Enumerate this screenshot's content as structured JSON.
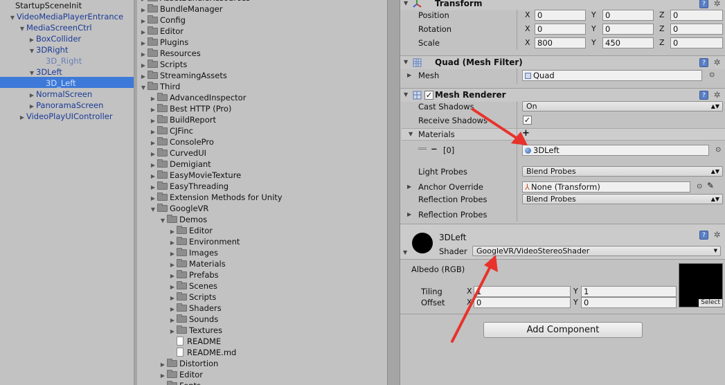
{
  "hierarchy": {
    "items": [
      {
        "label": "StartupSceneInit",
        "style": "plain",
        "arrow": ""
      },
      {
        "label": "VideoMediaPlayerEntrance",
        "style": "blue",
        "arrow": "▼"
      },
      {
        "label": "MediaScreenCtrl",
        "style": "blue",
        "arrow": "▼"
      },
      {
        "label": "BoxCollider",
        "style": "blue",
        "arrow": "▶"
      },
      {
        "label": "3DRight",
        "style": "blue",
        "arrow": "▼"
      },
      {
        "label": "3D_Right",
        "style": "faint",
        "arrow": ""
      },
      {
        "label": "3DLeft",
        "style": "blue",
        "arrow": "▼"
      },
      {
        "label": "3D_Left",
        "style": "selected",
        "arrow": ""
      },
      {
        "label": "NormalScreen",
        "style": "blue",
        "arrow": "▶"
      },
      {
        "label": "PanoramaScreen",
        "style": "blue",
        "arrow": "▶"
      },
      {
        "label": "VideoPlayUIController",
        "style": "blue",
        "arrow": "▶"
      }
    ]
  },
  "project": {
    "items": [
      {
        "label": "AssetBundleResources",
        "arrow": "▶",
        "type": "folder"
      },
      {
        "label": "BundleManager",
        "arrow": "▶",
        "type": "folder"
      },
      {
        "label": "Config",
        "arrow": "▶",
        "type": "folder"
      },
      {
        "label": "Editor",
        "arrow": "▶",
        "type": "folder"
      },
      {
        "label": "Plugins",
        "arrow": "▶",
        "type": "folder"
      },
      {
        "label": "Resources",
        "arrow": "▶",
        "type": "folder"
      },
      {
        "label": "Scripts",
        "arrow": "▶",
        "type": "folder"
      },
      {
        "label": "StreamingAssets",
        "arrow": "▶",
        "type": "folder"
      },
      {
        "label": "Third",
        "arrow": "▼",
        "type": "folder"
      },
      {
        "label": "AdvancedInspector",
        "arrow": "▶",
        "type": "folder"
      },
      {
        "label": "Best HTTP (Pro)",
        "arrow": "▶",
        "type": "folder"
      },
      {
        "label": "BuildReport",
        "arrow": "▶",
        "type": "folder"
      },
      {
        "label": "CJFinc",
        "arrow": "▶",
        "type": "folder"
      },
      {
        "label": "ConsolePro",
        "arrow": "▶",
        "type": "folder"
      },
      {
        "label": "CurvedUI",
        "arrow": "▶",
        "type": "folder"
      },
      {
        "label": "Demigiant",
        "arrow": "▶",
        "type": "folder"
      },
      {
        "label": "EasyMovieTexture",
        "arrow": "▶",
        "type": "folder"
      },
      {
        "label": "EasyThreading",
        "arrow": "▶",
        "type": "folder"
      },
      {
        "label": "Extension Methods for Unity",
        "arrow": "▶",
        "type": "folder"
      },
      {
        "label": "GoogleVR",
        "arrow": "▼",
        "type": "folder"
      },
      {
        "label": "Demos",
        "arrow": "▼",
        "type": "folder"
      },
      {
        "label": "Editor",
        "arrow": "▶",
        "type": "folder"
      },
      {
        "label": "Environment",
        "arrow": "▶",
        "type": "folder"
      },
      {
        "label": "Images",
        "arrow": "▶",
        "type": "folder"
      },
      {
        "label": "Materials",
        "arrow": "▶",
        "type": "folder"
      },
      {
        "label": "Prefabs",
        "arrow": "▶",
        "type": "folder"
      },
      {
        "label": "Scenes",
        "arrow": "▶",
        "type": "folder"
      },
      {
        "label": "Scripts",
        "arrow": "▶",
        "type": "folder"
      },
      {
        "label": "Shaders",
        "arrow": "▶",
        "type": "folder"
      },
      {
        "label": "Sounds",
        "arrow": "▶",
        "type": "folder"
      },
      {
        "label": "Textures",
        "arrow": "▶",
        "type": "folder"
      },
      {
        "label": "README",
        "arrow": "",
        "type": "file"
      },
      {
        "label": "README.md",
        "arrow": "",
        "type": "file"
      },
      {
        "label": "Distortion",
        "arrow": "▶",
        "type": "folder"
      },
      {
        "label": "Editor",
        "arrow": "▶",
        "type": "folder"
      },
      {
        "label": "Fonts",
        "arrow": "▶",
        "type": "folder"
      }
    ]
  },
  "inspector": {
    "transform": {
      "title": "Transform",
      "position_label": "Position",
      "rotation_label": "Rotation",
      "scale_label": "Scale",
      "axis_x": "X",
      "axis_y": "Y",
      "axis_z": "Z",
      "position": {
        "x": "0",
        "y": "0",
        "z": "0"
      },
      "rotation": {
        "x": "0",
        "y": "0",
        "z": "0"
      },
      "scale": {
        "x": "800",
        "y": "450",
        "z": "0"
      }
    },
    "mesh_filter": {
      "title": "Quad (Mesh Filter)",
      "mesh_label": "Mesh",
      "mesh_value": "Quad"
    },
    "mesh_renderer": {
      "title": "Mesh Renderer",
      "cast_shadows_label": "Cast Shadows",
      "cast_shadows_value": "On",
      "receive_shadows_label": "Receive Shadows",
      "receive_shadows_check": "✓",
      "materials_label": "Materials",
      "plus": "+",
      "element_label": "[0]",
      "material_value": "3DLeft",
      "light_probes_label": "Light Probes",
      "light_probes_value": "Blend Probes",
      "anchor_override_label": "Anchor Override",
      "anchor_override_value": "None (Transform)",
      "reflection_probes_label": "Reflection Probes",
      "reflection_probes_value": "Blend Probes",
      "reflection_probes_fold_label": "Reflection Probes"
    },
    "material": {
      "name": "3DLeft",
      "shader_label": "Shader",
      "shader_value": "GoogleVR/VideoStereoShader",
      "albedo_label": "Albedo (RGB)",
      "tiling_label": "Tiling",
      "offset_label": "Offset",
      "axis_x": "X",
      "axis_y": "Y",
      "tiling": {
        "x": "1",
        "y": "1"
      },
      "offset": {
        "x": "0",
        "y": "0"
      },
      "select_label": "Select"
    },
    "add_component_label": "Add Component"
  },
  "colors": {
    "selection": "#3d79d8",
    "arrow": "#e8322c",
    "hierarchy_blue": "#1a3a96"
  }
}
